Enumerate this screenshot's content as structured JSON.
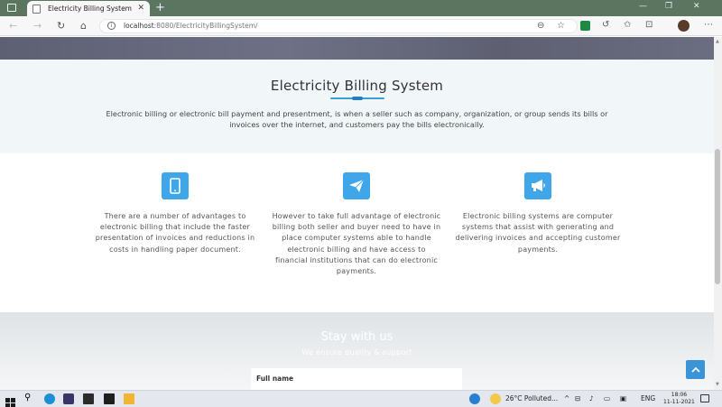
{
  "browser": {
    "tab_title": "Electricity Billing System",
    "url_host": "localhost",
    "url_path": ":8080/ElectricityBillingSystem/"
  },
  "about": {
    "title": "Electricity Billing System",
    "text": "Electronic billing or electronic bill payment and presentment, is when a seller such as company, organization, or group sends its bills or invoices over the internet, and customers pay the bills electronically."
  },
  "features": [
    {
      "icon": "mobile-icon",
      "text": "There are a number of advantages to electronic billing that include the faster presentation of invoices and reductions in costs in handling paper document."
    },
    {
      "icon": "paper-plane-icon",
      "text": "However to take full advantage of electronic billing both seller and buyer need to have in place computer systems able to handle electronic billing and have access to financial institutions that can do electronic payments."
    },
    {
      "icon": "megaphone-icon",
      "text": "Electronic billing systems are computer systems that assist with generating and delivering invoices and accepting customer payments."
    }
  ],
  "stay": {
    "title": "Stay with us",
    "subtitle": "We ensure quality & support",
    "form_label": "Full name"
  },
  "taskbar": {
    "weather": "26°C  Polluted...",
    "lang": "ENG",
    "time": "18:06",
    "date": "11-11-2021"
  },
  "colors": {
    "accent": "#3fa6ea",
    "tabstrip": "#5b7560",
    "about_bg": "#f1f7f8"
  }
}
